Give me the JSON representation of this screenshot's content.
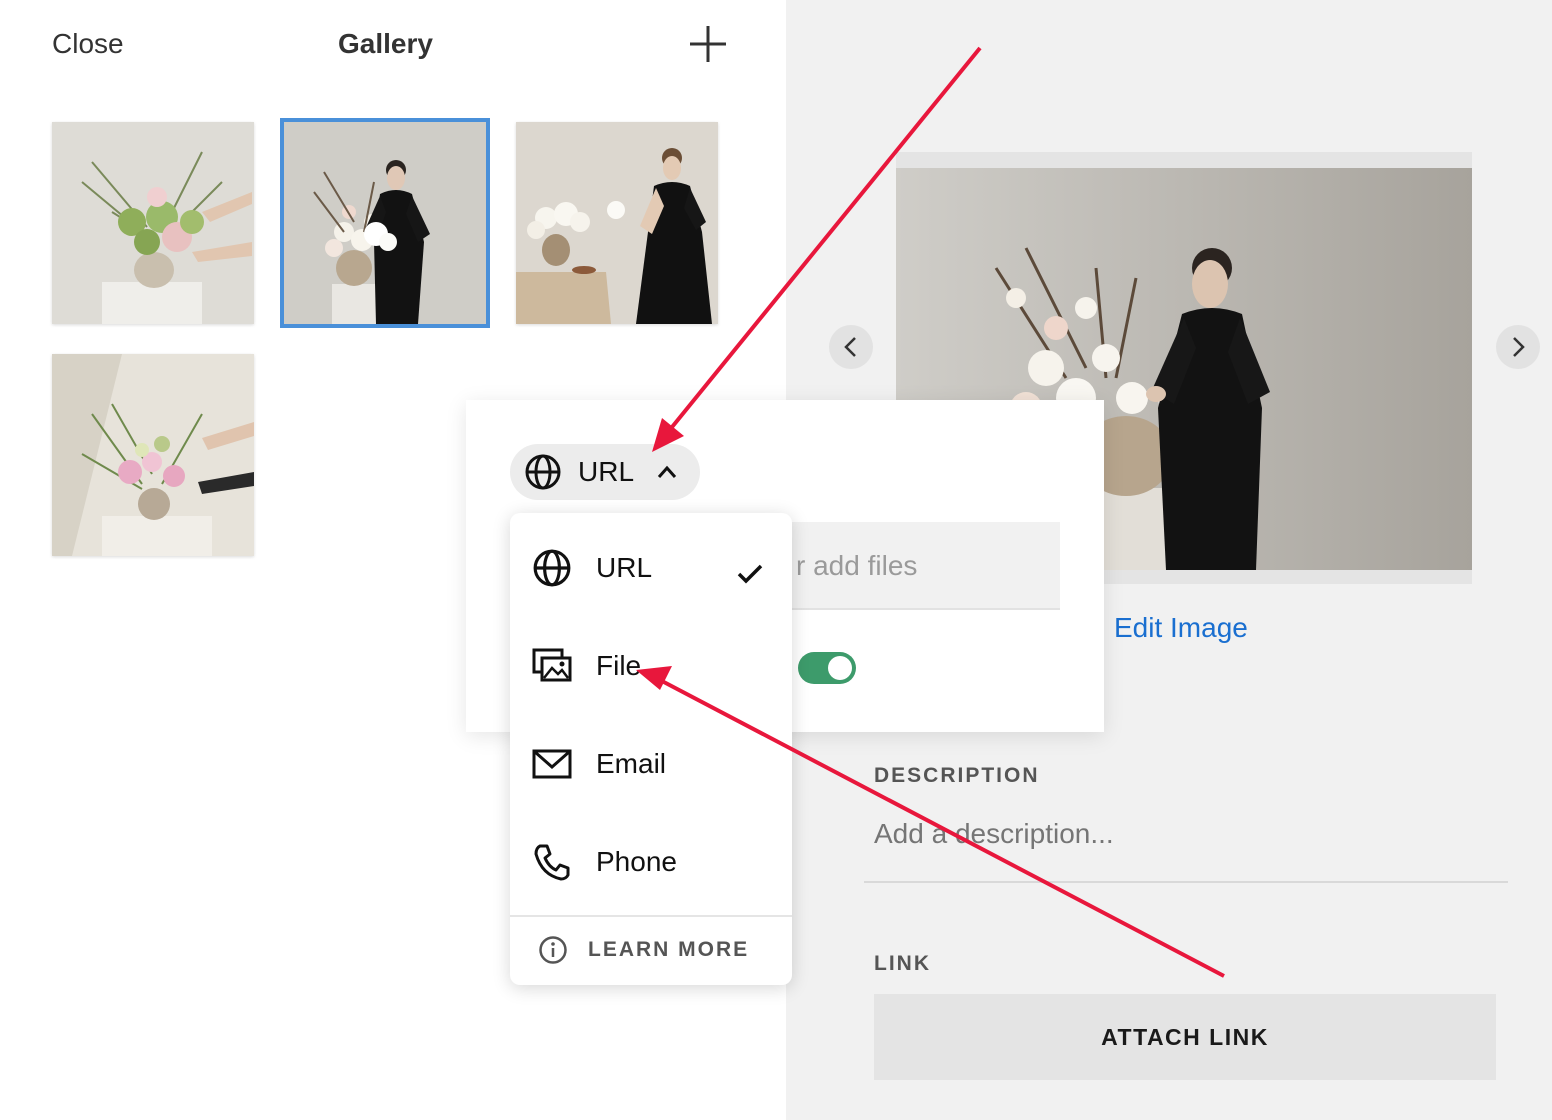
{
  "header": {
    "close_label": "Close",
    "title": "Gallery",
    "add_icon": "plus-icon"
  },
  "gallery": {
    "thumbnails": [
      {
        "name": "thumb-1",
        "selected": false
      },
      {
        "name": "thumb-2",
        "selected": true
      },
      {
        "name": "thumb-3",
        "selected": false
      },
      {
        "name": "thumb-4",
        "selected": false
      }
    ]
  },
  "preview": {
    "prev_icon": "chevron-left-icon",
    "next_icon": "chevron-right-icon",
    "edit_label": "Edit Image"
  },
  "details": {
    "description_label": "DESCRIPTION",
    "description_placeholder": "Add a description...",
    "link_label": "LINK",
    "attach_label": "ATTACH LINK"
  },
  "link_dialog": {
    "type_selected": "URL",
    "input_partial_text": "r add files",
    "toggle_on": true
  },
  "link_type_menu": {
    "items": [
      {
        "label": "URL",
        "icon": "globe-icon",
        "checked": true
      },
      {
        "label": "File",
        "icon": "image-file-icon",
        "checked": false
      },
      {
        "label": "Email",
        "icon": "envelope-icon",
        "checked": false
      },
      {
        "label": "Phone",
        "icon": "phone-icon",
        "checked": false
      }
    ],
    "learn_more": "LEARN MORE"
  },
  "colors": {
    "accent_blue": "#1a6fd0",
    "selection_outline": "#4a90d9",
    "toggle_green": "#3d9b6b",
    "annotation_red": "#e8173c"
  }
}
